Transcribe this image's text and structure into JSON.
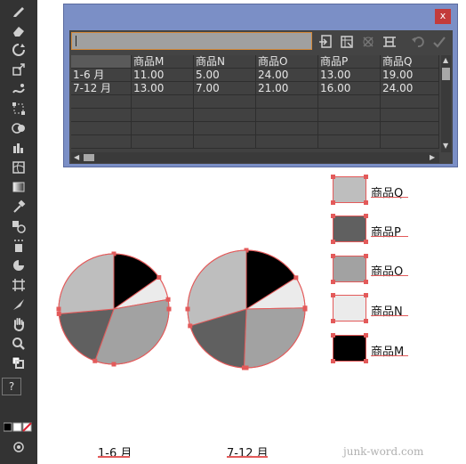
{
  "toolbar": {
    "tools": [
      "pencil-icon",
      "eraser-icon",
      "rotate-icon",
      "scale-icon",
      "warp-icon",
      "free-transform-icon",
      "shape-builder-icon",
      "graph-icon",
      "mesh-icon",
      "gradient-icon",
      "eyedropper-icon",
      "blend-icon",
      "symbol-sprayer-icon",
      "pie-graph-icon",
      "artboard-icon",
      "slice-icon",
      "hand-icon",
      "zoom-icon"
    ],
    "help_label": "?"
  },
  "dialog": {
    "close_label": "x",
    "entry_value": "",
    "header_row": [
      "",
      "商品M",
      "商品N",
      "商品O",
      "商品P",
      "商品Q"
    ],
    "rows": [
      [
        "1-6 月",
        "11.00",
        "5.00",
        "24.00",
        "13.00",
        "19.00"
      ],
      [
        "7-12 月",
        "13.00",
        "7.00",
        "21.00",
        "16.00",
        "24.00"
      ]
    ]
  },
  "charts": {
    "colors": {
      "商品M": "#000000",
      "商品N": "#ebebeb",
      "商品O": "#a2a2a2",
      "商品P": "#606060",
      "商品Q": "#bebebe"
    },
    "pies": [
      {
        "label": "1-6 月",
        "values": [
          11,
          5,
          24,
          13,
          19
        ]
      },
      {
        "label": "7-12 月",
        "values": [
          13,
          7,
          21,
          16,
          24
        ]
      }
    ]
  },
  "legend": [
    {
      "label": "商品Q",
      "color": "#bebebe"
    },
    {
      "label": "商品P",
      "color": "#606060"
    },
    {
      "label": "商品O",
      "color": "#a2a2a2"
    },
    {
      "label": "商品N",
      "color": "#ebebeb"
    },
    {
      "label": "商品M",
      "color": "#000000"
    }
  ],
  "watermark": "junk-word.com"
}
